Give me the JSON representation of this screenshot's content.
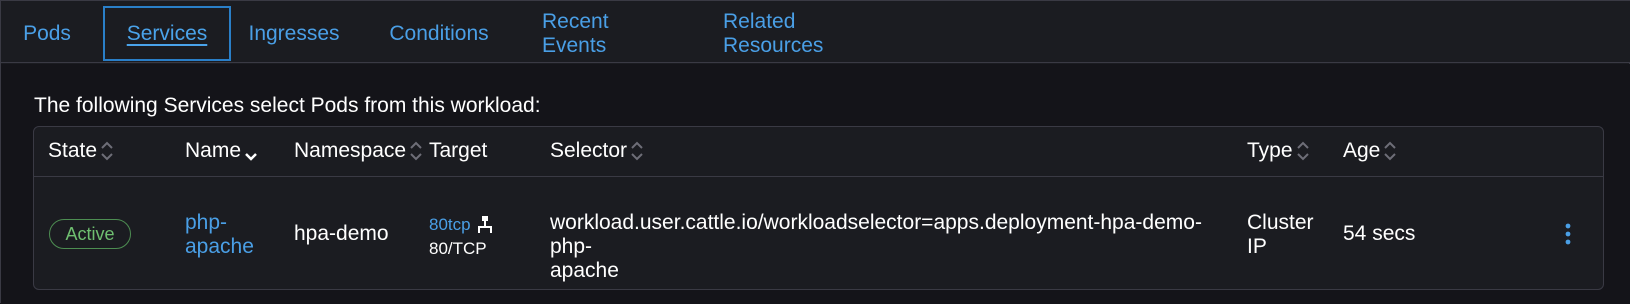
{
  "tabs": [
    {
      "label": "Pods"
    },
    {
      "label": "Services"
    },
    {
      "label": "Ingresses"
    },
    {
      "label": "Conditions"
    },
    {
      "label": "Recent Events"
    },
    {
      "label": "Related Resources"
    }
  ],
  "intro": "The following Services select Pods from this workload:",
  "table": {
    "headers": {
      "state": "State",
      "name": "Name",
      "namespace": "Namespace",
      "target": "Target",
      "selector": "Selector",
      "type": "Type",
      "age": "Age"
    },
    "row": {
      "state": "Active",
      "name_line1": "php-",
      "name_line2": "apache",
      "namespace": "hpa-demo",
      "target_link": "80tcp",
      "target_port": "80/TCP",
      "selector_line1": "workload.user.cattle.io/workloadselector=apps.deployment-hpa-demo-php-",
      "selector_line2": "apache",
      "type_line1": "Cluster",
      "type_line2": "IP",
      "age": "54 secs"
    }
  },
  "colors": {
    "accent": "#4a9fe6",
    "active_badge": "#6fbf70",
    "background": "#141419"
  }
}
